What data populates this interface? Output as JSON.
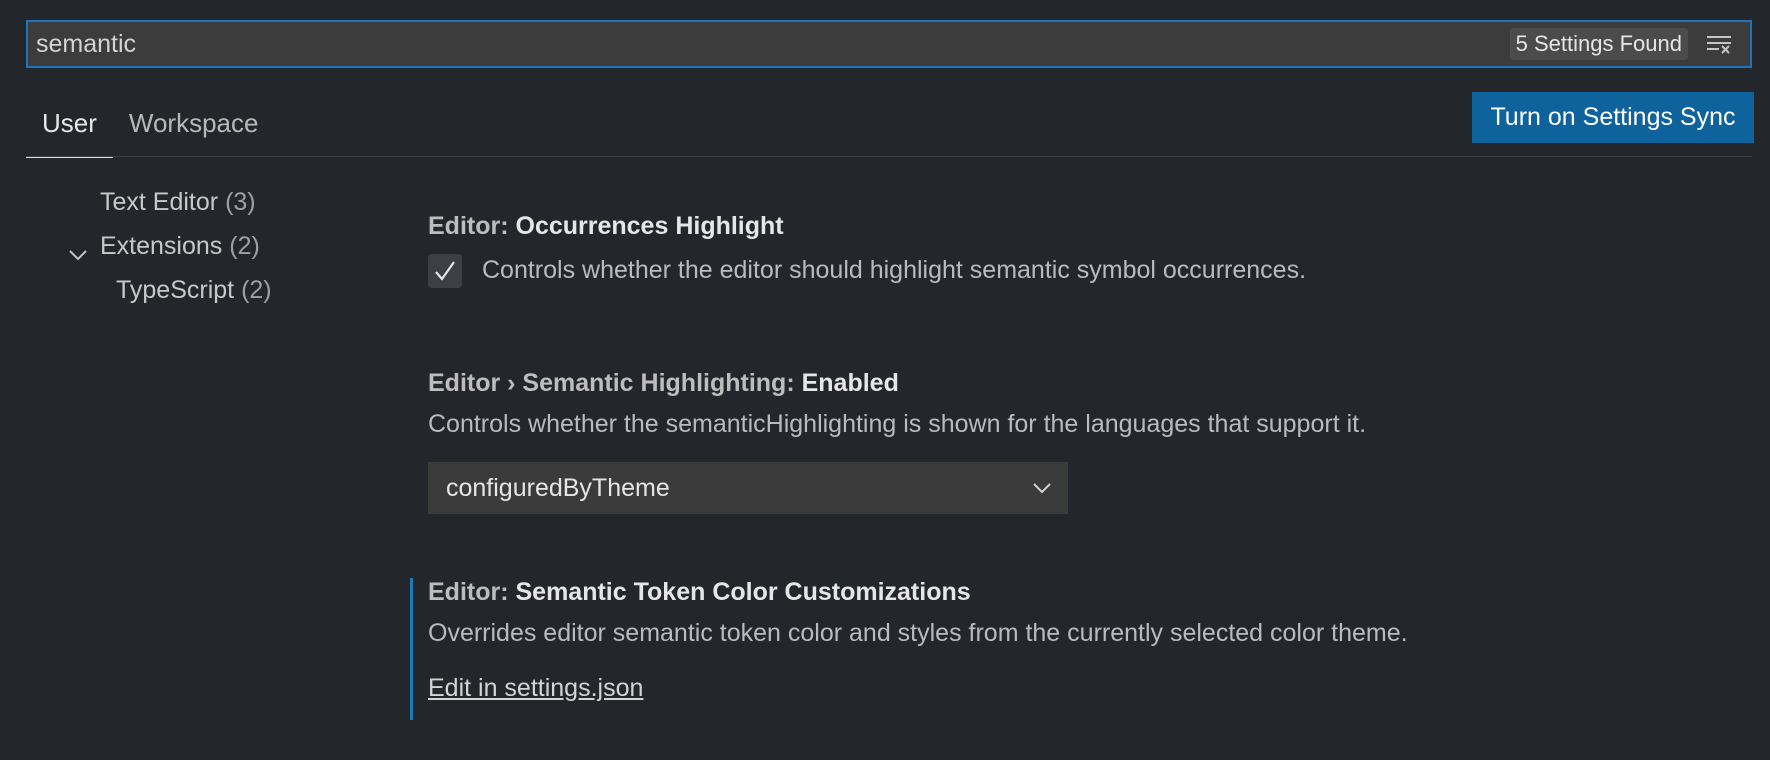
{
  "search": {
    "value": "semantic",
    "result_count": "5 Settings Found",
    "clear_icon": "clear-filter-icon"
  },
  "tabs": [
    {
      "label": "User",
      "active": true
    },
    {
      "label": "Workspace",
      "active": false
    }
  ],
  "sync_button": {
    "label": "Turn on Settings Sync"
  },
  "colors": {
    "accent": "#0e639c",
    "focus_border": "#1f74c0",
    "background": "#23262b"
  },
  "toc": {
    "items": [
      {
        "label": "Text Editor",
        "count": "(3)"
      },
      {
        "label": "Extensions",
        "count": "(2)",
        "expanded": true
      },
      {
        "label": "TypeScript",
        "count": "(2)"
      }
    ]
  },
  "settings": {
    "occurrences": {
      "category": "Editor: ",
      "name": "Occurrences Highlight",
      "description": "Controls whether the editor should highlight semantic symbol occurrences.",
      "checked": true
    },
    "semantic_highlighting": {
      "category": "Editor › Semantic Highlighting: ",
      "name": "Enabled",
      "description": "Controls whether the semanticHighlighting is shown for the languages that support it.",
      "selected": "configuredByTheme"
    },
    "token_colors": {
      "category": "Editor: ",
      "name": "Semantic Token Color Customizations",
      "description": "Overrides editor semantic token color and styles from the currently selected color theme.",
      "link": "Edit in settings.json"
    }
  }
}
